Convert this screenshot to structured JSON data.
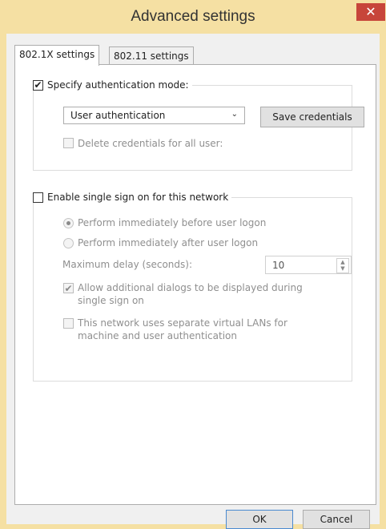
{
  "window": {
    "title": "Advanced settings",
    "close_glyph": "✕"
  },
  "tabs": [
    {
      "label": "802.1X settings",
      "active": true
    },
    {
      "label": "802.11 settings",
      "active": false
    }
  ],
  "auth": {
    "specify_label": "Specify authentication mode:",
    "specify_checked": true,
    "mode_value": "User authentication",
    "save_label": "Save credentials",
    "delete_label": "Delete credentials for all user:",
    "delete_checked": false
  },
  "sso": {
    "enable_label": "Enable single sign on for this network",
    "enable_checked": false,
    "before_label": "Perform immediately before user logon",
    "after_label": "Perform immediately after user logon",
    "delay_label": "Maximum delay (seconds):",
    "delay_value": "10",
    "allow_label": "Allow additional dialogs to be displayed during single sign on",
    "allow_checked": true,
    "vlan_label": "This network uses separate virtual LANs for machine and user authentication",
    "vlan_checked": false
  },
  "buttons": {
    "ok": "OK",
    "cancel": "Cancel"
  },
  "glyphs": {
    "check": "✔",
    "chevron": "⌄",
    "up": "▲",
    "down": "▼"
  },
  "colors": {
    "title_bar": "#f5e0a3",
    "close": "#c7453a",
    "ok_border": "#4a8ad0"
  }
}
